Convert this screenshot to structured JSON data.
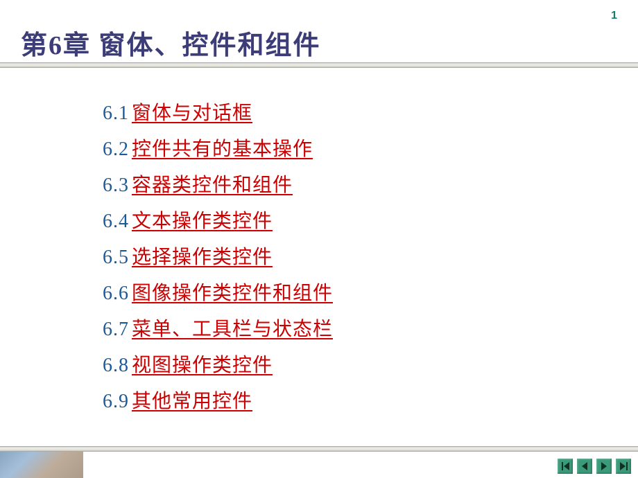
{
  "page_number": "1",
  "title": "第6章 窗体、控件和组件",
  "toc": [
    {
      "num": "6.1",
      "label": " 窗体与对话框"
    },
    {
      "num": "6.2",
      "label": " 控件共有的基本操作"
    },
    {
      "num": "6.3",
      "label": " 容器类控件和组件"
    },
    {
      "num": "6.4",
      "label": " 文本操作类控件"
    },
    {
      "num": "6.5",
      "label": " 选择操作类控件"
    },
    {
      "num": "6.6",
      "label": " 图像操作类控件和组件"
    },
    {
      "num": "6.7",
      "label": " 菜单、工具栏与状态栏"
    },
    {
      "num": "6.8",
      "label": " 视图操作类控件"
    },
    {
      "num": "6.9",
      "label": " 其他常用控件"
    }
  ],
  "nav": {
    "first": "first-slide",
    "prev": "previous-slide",
    "next": "next-slide",
    "last": "last-slide"
  }
}
